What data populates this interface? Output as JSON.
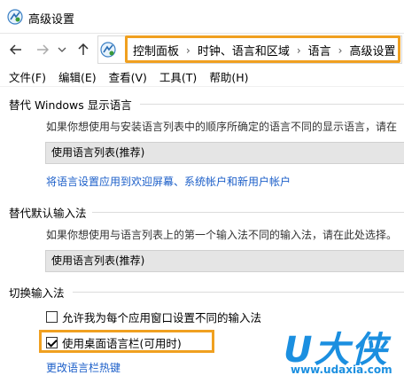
{
  "window": {
    "title": "高级设置"
  },
  "address": {
    "breadcrumbs": [
      "控制面板",
      "时钟、语言和区域",
      "语言",
      "高级设置"
    ],
    "separator": "›"
  },
  "menu": {
    "items": [
      "文件(F)",
      "编辑(E)",
      "查看(V)",
      "工具(T)",
      "帮助(H)"
    ]
  },
  "display_language": {
    "heading": "替代 Windows 显示语言",
    "description": "如果你想使用与安装语言列表中的顺序所确定的语言不同的显示语言，请在",
    "selected": "使用语言列表(推荐)",
    "link": "将语言设置应用到欢迎屏幕、系统帐户和新用户帐户"
  },
  "input_method": {
    "heading": "替代默认输入法",
    "description": "如果你想使用与语言列表上的第一个输入法不同的输入法，请在此处选择。",
    "selected": "使用语言列表(推荐)"
  },
  "switch_input": {
    "heading": "切换输入法",
    "option1": {
      "label": "允许我为每个应用窗口设置不同的输入法",
      "checked": false
    },
    "option2": {
      "label": "使用桌面语言栏(可用时)",
      "checked": true
    },
    "link": "更改语言栏热键"
  },
  "watermark": {
    "logo": "U大侠",
    "url": "www.udaxia.com"
  },
  "colors": {
    "highlight": "#f0a020",
    "link": "#1c5fc9",
    "watermark": "#1b8fe0"
  }
}
